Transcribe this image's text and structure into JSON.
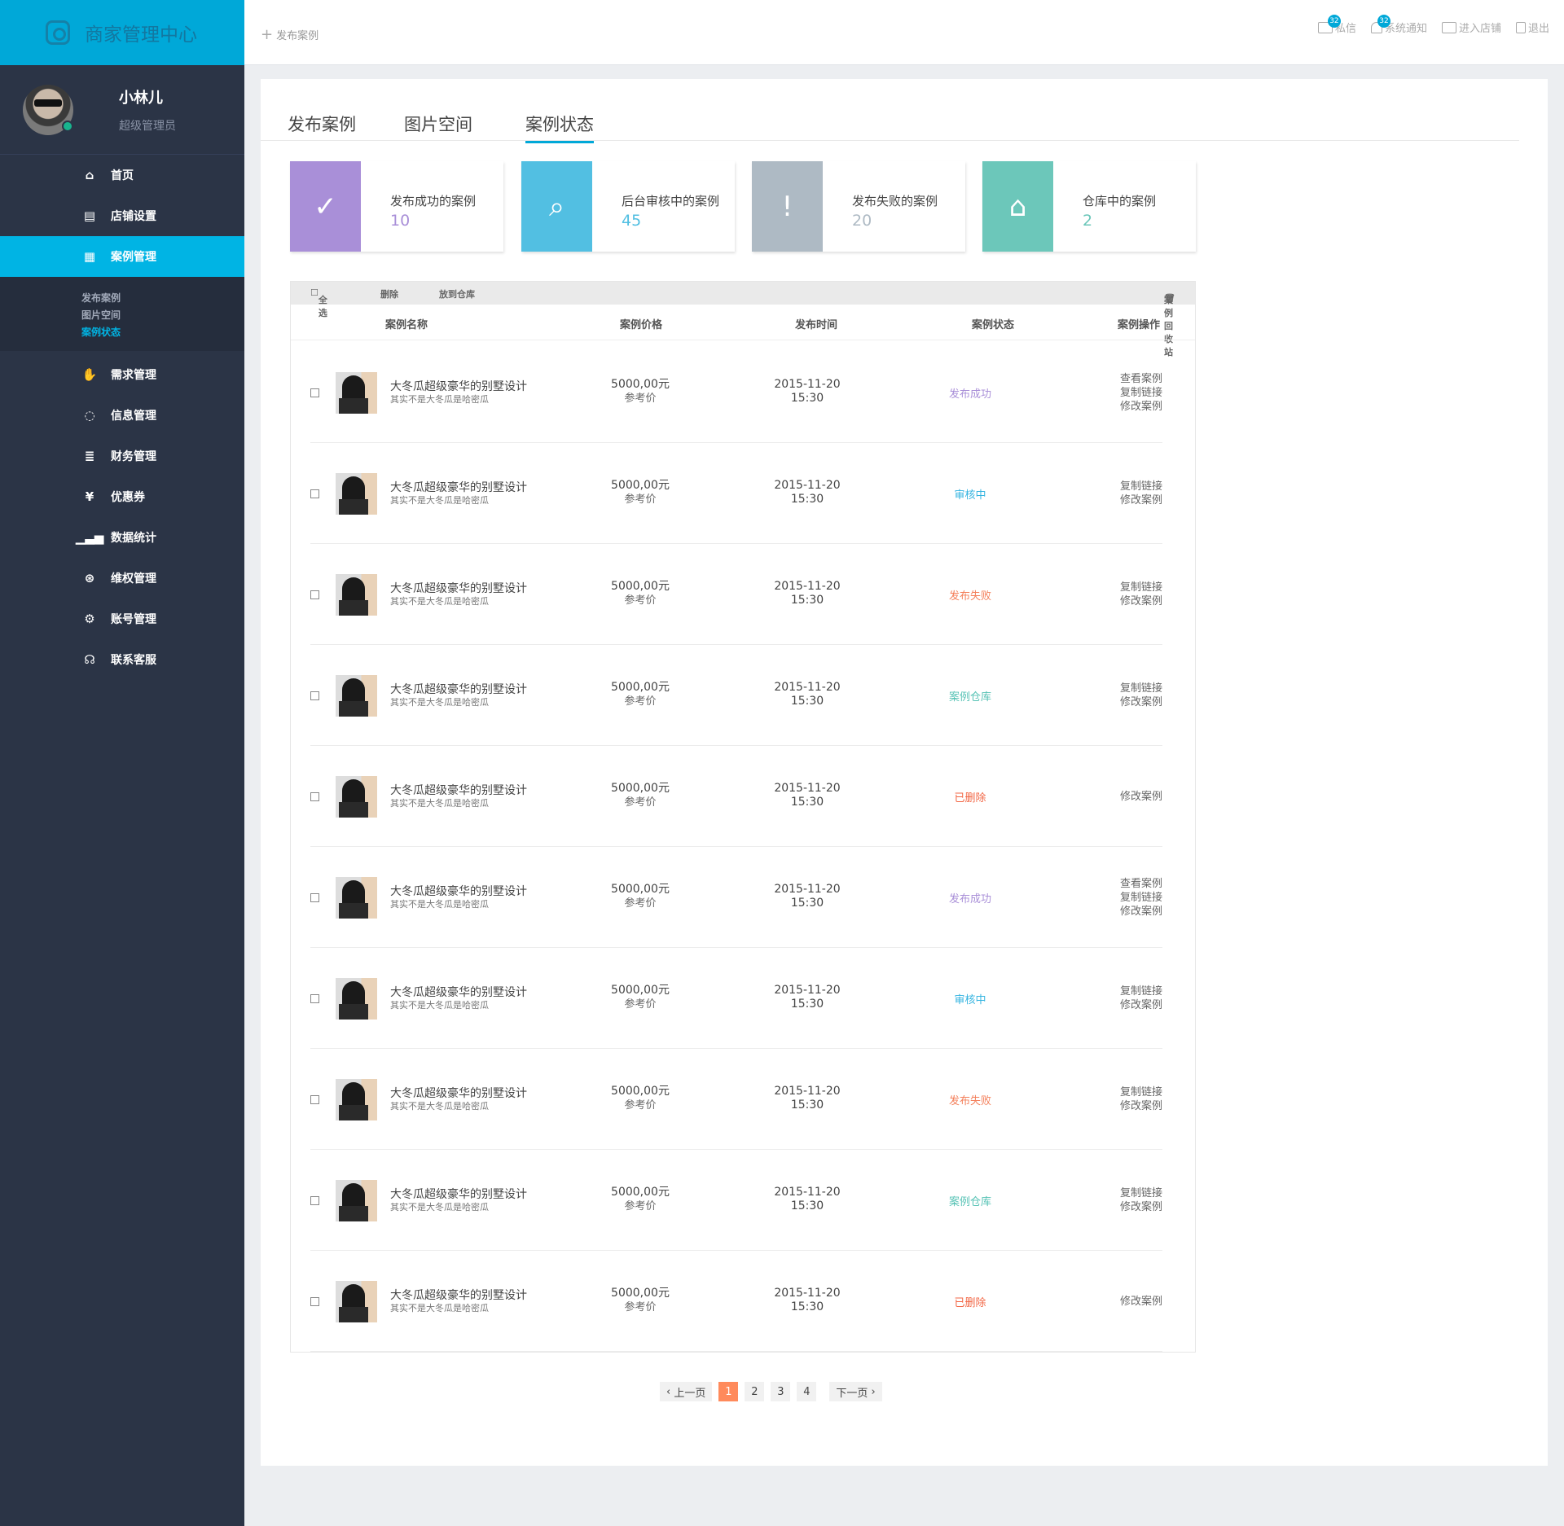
{
  "brand": {
    "title": "商家管理中心"
  },
  "profile": {
    "name": "小林儿",
    "role": "超级管理员"
  },
  "nav": {
    "home": "首页",
    "shop": "店铺设置",
    "cases": "案例管理",
    "sub": [
      "发布案例",
      "图片空间",
      "案例状态"
    ],
    "demand": "需求管理",
    "message": "信息管理",
    "finance": "财务管理",
    "coupon": "优惠券",
    "stats": "数据统计",
    "rights": "维权管理",
    "account": "账号管理",
    "service": "联系客服"
  },
  "topbar": {
    "publish": "发布案例",
    "mail": "私信",
    "mail_count": "32",
    "notice": "系统通知",
    "notice_count": "32",
    "enter_shop": "进入店铺",
    "logout": "退出"
  },
  "tabs": [
    "发布案例",
    "图片空间",
    "案例状态"
  ],
  "cards": [
    {
      "label": "发布成功的案例",
      "value": "10",
      "color": "#a98fd8"
    },
    {
      "label": "后台审核中的案例",
      "value": "45",
      "color": "#52bfe2"
    },
    {
      "label": "发布失败的案例",
      "value": "20",
      "color": "#aebac4"
    },
    {
      "label": "仓库中的案例",
      "value": "2",
      "color": "#6cc7ba"
    }
  ],
  "toolbar": {
    "select_all": "全选",
    "delete": "删除",
    "to_warehouse": "放到仓库",
    "recycle": "案例回收站"
  },
  "thead": {
    "name": "案例名称",
    "price": "案例价格",
    "time": "发布时间",
    "status": "案例状态",
    "ops": "案例操作"
  },
  "rows": [
    {
      "name": "大冬瓜超级豪华的别墅设计",
      "sub": "其实不是大冬瓜是哈密瓜",
      "price": "5000,00元",
      "price_note": "参考价",
      "date": "2015-11-20",
      "clock": "15:30",
      "status": "发布成功",
      "status_color": "#a98fd8",
      "ops": [
        "查看案例",
        "复制链接",
        "修改案例"
      ]
    },
    {
      "name": "大冬瓜超级豪华的别墅设计",
      "sub": "其实不是大冬瓜是哈密瓜",
      "price": "5000,00元",
      "price_note": "参考价",
      "date": "2015-11-20",
      "clock": "15:30",
      "status": "审核中",
      "status_color": "#34b4e0",
      "ops": [
        "复制链接",
        "修改案例"
      ]
    },
    {
      "name": "大冬瓜超级豪华的别墅设计",
      "sub": "其实不是大冬瓜是哈密瓜",
      "price": "5000,00元",
      "price_note": "参考价",
      "date": "2015-11-20",
      "clock": "15:30",
      "status": "发布失败",
      "status_color": "#f47f5a",
      "ops": [
        "复制链接",
        "修改案例"
      ]
    },
    {
      "name": "大冬瓜超级豪华的别墅设计",
      "sub": "其实不是大冬瓜是哈密瓜",
      "price": "5000,00元",
      "price_note": "参考价",
      "date": "2015-11-20",
      "clock": "15:30",
      "status": "案例仓库",
      "status_color": "#55c2b4",
      "ops": [
        "复制链接",
        "修改案例"
      ]
    },
    {
      "name": "大冬瓜超级豪华的别墅设计",
      "sub": "其实不是大冬瓜是哈密瓜",
      "price": "5000,00元",
      "price_note": "参考价",
      "date": "2015-11-20",
      "clock": "15:30",
      "status": "已删除",
      "status_color": "#f26644",
      "ops": [
        "修改案例"
      ]
    },
    {
      "name": "大冬瓜超级豪华的别墅设计",
      "sub": "其实不是大冬瓜是哈密瓜",
      "price": "5000,00元",
      "price_note": "参考价",
      "date": "2015-11-20",
      "clock": "15:30",
      "status": "发布成功",
      "status_color": "#a98fd8",
      "ops": [
        "查看案例",
        "复制链接",
        "修改案例"
      ]
    },
    {
      "name": "大冬瓜超级豪华的别墅设计",
      "sub": "其实不是大冬瓜是哈密瓜",
      "price": "5000,00元",
      "price_note": "参考价",
      "date": "2015-11-20",
      "clock": "15:30",
      "status": "审核中",
      "status_color": "#34b4e0",
      "ops": [
        "复制链接",
        "修改案例"
      ]
    },
    {
      "name": "大冬瓜超级豪华的别墅设计",
      "sub": "其实不是大冬瓜是哈密瓜",
      "price": "5000,00元",
      "price_note": "参考价",
      "date": "2015-11-20",
      "clock": "15:30",
      "status": "发布失败",
      "status_color": "#f47f5a",
      "ops": [
        "复制链接",
        "修改案例"
      ]
    },
    {
      "name": "大冬瓜超级豪华的别墅设计",
      "sub": "其实不是大冬瓜是哈密瓜",
      "price": "5000,00元",
      "price_note": "参考价",
      "date": "2015-11-20",
      "clock": "15:30",
      "status": "案例仓库",
      "status_color": "#55c2b4",
      "ops": [
        "复制链接",
        "修改案例"
      ]
    },
    {
      "name": "大冬瓜超级豪华的别墅设计",
      "sub": "其实不是大冬瓜是哈密瓜",
      "price": "5000,00元",
      "price_note": "参考价",
      "date": "2015-11-20",
      "clock": "15:30",
      "status": "已删除",
      "status_color": "#f26644",
      "ops": [
        "修改案例"
      ]
    }
  ],
  "pager": {
    "prev": "上一页",
    "pages": [
      "1",
      "2",
      "3",
      "4"
    ],
    "current": "1",
    "next": "下一页"
  }
}
